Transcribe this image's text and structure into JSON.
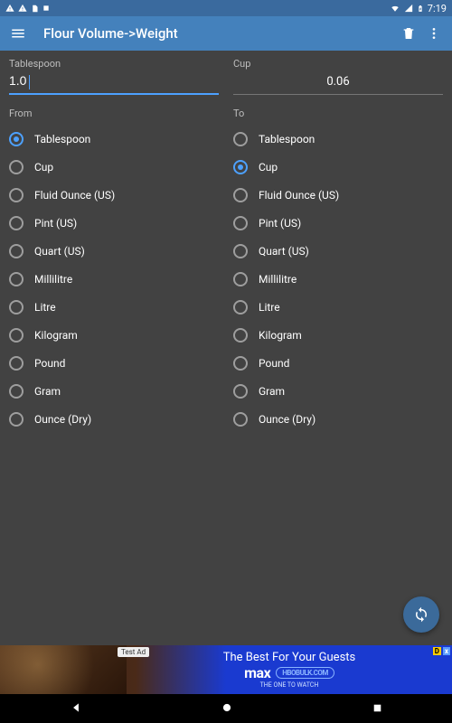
{
  "status": {
    "time": "7:19"
  },
  "appbar": {
    "title": "Flour Volume->Weight"
  },
  "from": {
    "unit_label": "Tablespoon",
    "value": "1.0",
    "section": "From",
    "selected": "Tablespoon"
  },
  "to": {
    "unit_label": "Cup",
    "value": "0.06",
    "section": "To",
    "selected": "Cup"
  },
  "units": [
    "Tablespoon",
    "Cup",
    "Fluid Ounce (US)",
    "Pint (US)",
    "Quart (US)",
    "Millilitre",
    "Litre",
    "Kilogram",
    "Pound",
    "Gram",
    "Ounce (Dry)"
  ],
  "ad": {
    "test_label": "Test Ad",
    "headline": "The Best For Your Guests",
    "brand": "max",
    "cta": "HBOBULK.COM",
    "subline": "THE ONE TO WATCH",
    "ad_badge": "D",
    "close": "x"
  }
}
